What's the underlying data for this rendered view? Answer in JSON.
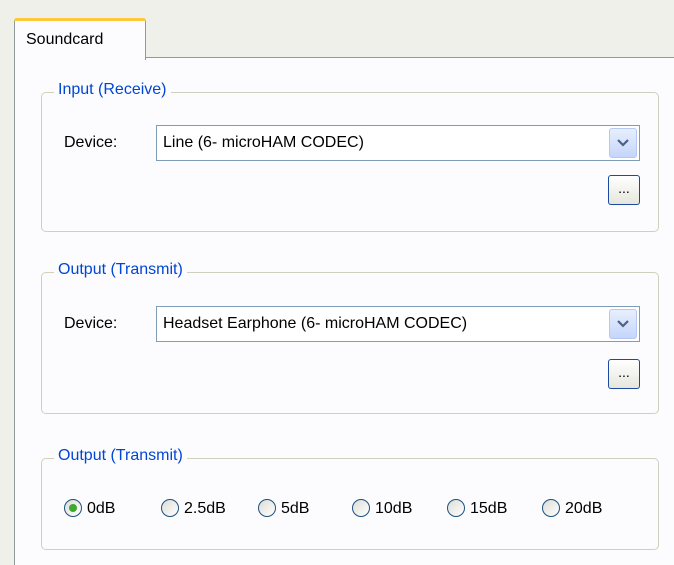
{
  "tab": {
    "label": "Soundcard"
  },
  "input_group": {
    "legend": "Input (Receive)",
    "device_label": "Device:",
    "device_value": "Line (6- microHAM CODEC)",
    "more_button": "..."
  },
  "output_group": {
    "legend": "Output (Transmit)",
    "device_label": "Device:",
    "device_value": "Headset Earphone (6- microHAM CODEC)",
    "more_button": "..."
  },
  "level_group": {
    "legend": "Output (Transmit)",
    "options": [
      "0dB",
      "2.5dB",
      "5dB",
      "10dB",
      "15dB",
      "20dB"
    ],
    "selected": "0dB"
  },
  "colors": {
    "legend": "#0046d5",
    "tab_highlight": "#ffc83c",
    "radio_selected": "#3fa82e"
  }
}
